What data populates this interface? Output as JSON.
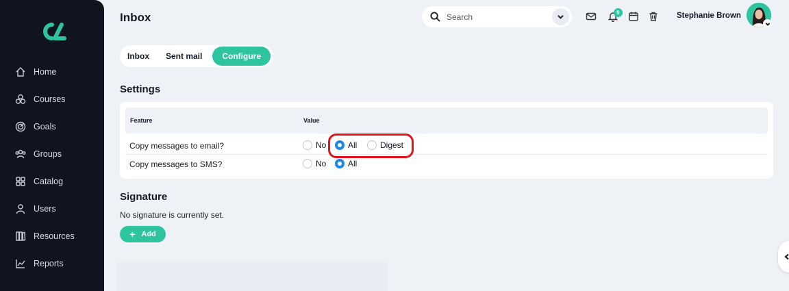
{
  "header": {
    "title": "Inbox"
  },
  "search": {
    "placeholder": "Search"
  },
  "notifications": {
    "count": "9"
  },
  "user": {
    "name": "Stephanie Brown"
  },
  "sidebar": {
    "items": [
      {
        "label": "Home",
        "icon": "home-icon"
      },
      {
        "label": "Courses",
        "icon": "courses-icon"
      },
      {
        "label": "Goals",
        "icon": "goals-icon"
      },
      {
        "label": "Groups",
        "icon": "groups-icon"
      },
      {
        "label": "Catalog",
        "icon": "catalog-icon"
      },
      {
        "label": "Users",
        "icon": "users-icon"
      },
      {
        "label": "Resources",
        "icon": "resources-icon"
      },
      {
        "label": "Reports",
        "icon": "reports-icon"
      }
    ]
  },
  "tabs": [
    {
      "label": "Inbox",
      "active": false
    },
    {
      "label": "Sent mail",
      "active": false
    },
    {
      "label": "Configure",
      "active": true
    }
  ],
  "settings": {
    "title": "Settings",
    "columns": {
      "feature": "Feature",
      "value": "Value"
    },
    "rows": [
      {
        "feature": "Copy messages to email?",
        "options": [
          "No",
          "All",
          "Digest"
        ],
        "selected": "All"
      },
      {
        "feature": "Copy messages to SMS?",
        "options": [
          "No",
          "All"
        ],
        "selected": "All"
      }
    ]
  },
  "signature": {
    "title": "Signature",
    "text": "No signature is currently set.",
    "add_label": "Add"
  },
  "colors": {
    "accent": "#2ec4a0",
    "sidebar_bg": "#0f1420",
    "radio_on": "#1e88e5",
    "highlight": "#e0121c"
  }
}
